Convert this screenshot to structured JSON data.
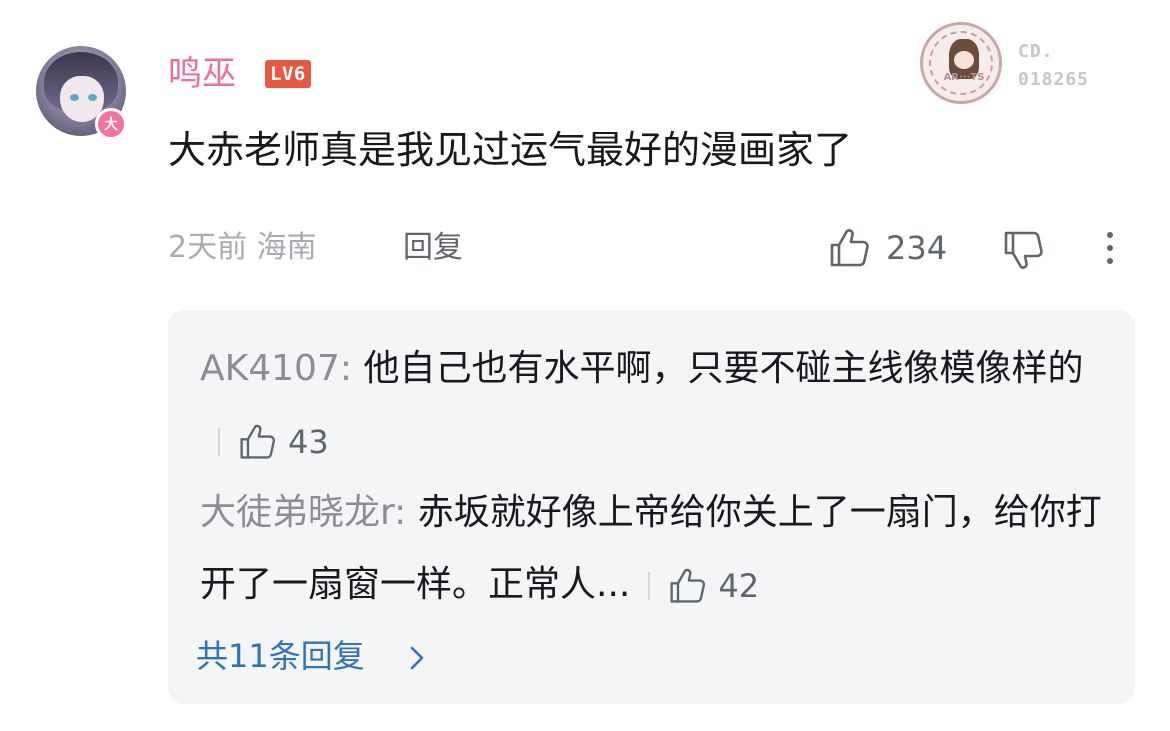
{
  "comment": {
    "username": "鸣巫",
    "level": "LV6",
    "vip_badge": "大",
    "fan_badge": {
      "label": "CD.",
      "number": "018265",
      "emblem_text": "AR···TS"
    },
    "text": "大赤老师真是我见过运气最好的漫画家了",
    "time": "2天前",
    "location": "海南",
    "reply_label": "回复",
    "like_count": "234"
  },
  "replies": [
    {
      "name": "AK4107",
      "text": "他自己也有水平啊，只要不碰主线像模像样的",
      "likes": "43"
    },
    {
      "name": "大徒弟晓龙r",
      "text": "赤坂就好像上帝给你关上了一扇门，给你打开了一扇窗一样。正常人...",
      "likes": "42"
    }
  ],
  "total_replies": "共11条回复",
  "colors": {
    "username": "#ee6f9b",
    "level_badge": "#e8573f",
    "link": "#2f74b8",
    "reply_bg": "#f4f5f7"
  }
}
